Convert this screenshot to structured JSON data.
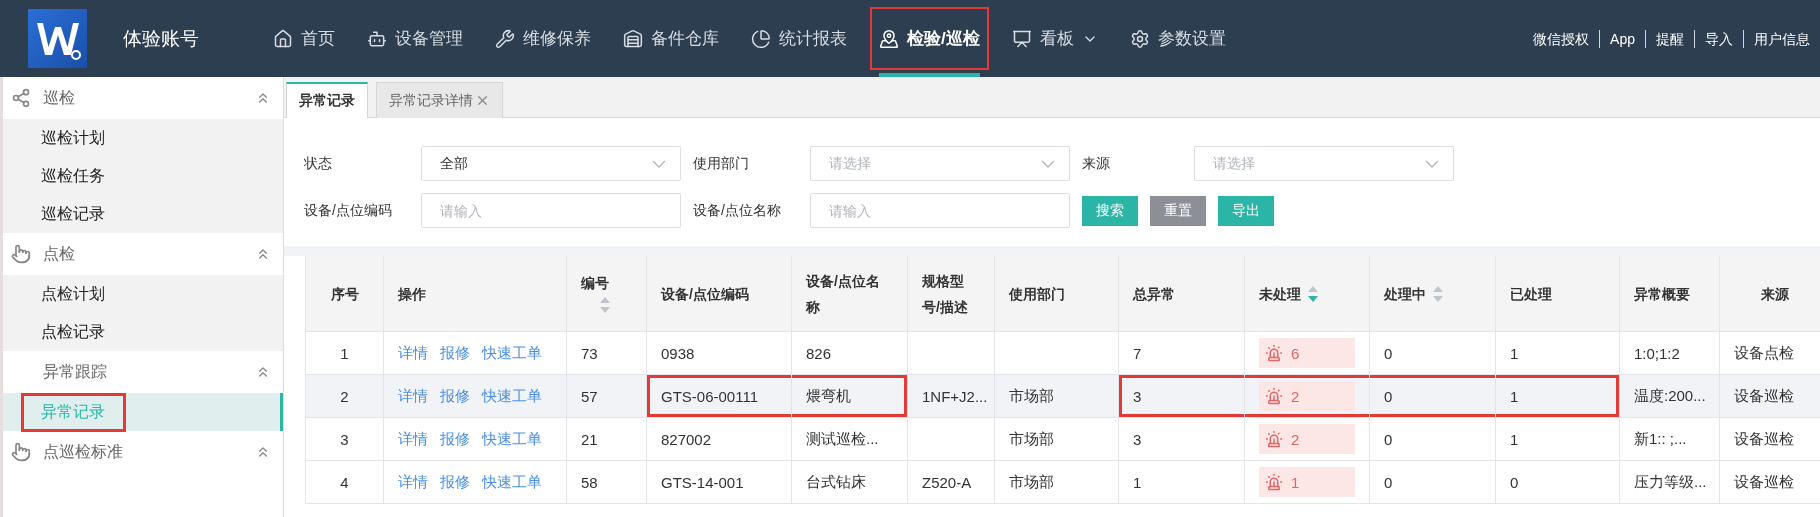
{
  "header": {
    "account": "体验账号",
    "nav": [
      {
        "label": "首页",
        "selected": false,
        "highlighted": false,
        "dropdown": false
      },
      {
        "label": "设备管理",
        "selected": false,
        "highlighted": false,
        "dropdown": false
      },
      {
        "label": "维修保养",
        "selected": false,
        "highlighted": false,
        "dropdown": false
      },
      {
        "label": "备件仓库",
        "selected": false,
        "highlighted": false,
        "dropdown": false
      },
      {
        "label": "统计报表",
        "selected": false,
        "highlighted": false,
        "dropdown": false
      },
      {
        "label": "检验/巡检",
        "selected": true,
        "highlighted": true,
        "dropdown": false
      },
      {
        "label": "看板",
        "selected": false,
        "highlighted": false,
        "dropdown": true
      },
      {
        "label": "参数设置",
        "selected": false,
        "highlighted": false,
        "dropdown": false
      }
    ],
    "links": [
      "微信授权",
      "App",
      "提醒",
      "导入",
      "用户信息"
    ]
  },
  "sidebar": {
    "groups": [
      {
        "label": "巡检",
        "expanded": true,
        "children": [
          {
            "label": "巡检计划",
            "selected": false,
            "highlighted": false
          },
          {
            "label": "巡检任务",
            "selected": false,
            "highlighted": false
          },
          {
            "label": "巡检记录",
            "selected": false,
            "highlighted": false
          }
        ]
      },
      {
        "label": "点检",
        "expanded": true,
        "children": [
          {
            "label": "点检计划",
            "selected": false,
            "highlighted": false
          },
          {
            "label": "点检记录",
            "selected": false,
            "highlighted": false
          }
        ]
      },
      {
        "label": "异常跟踪",
        "expanded": true,
        "children": [
          {
            "label": "异常记录",
            "selected": true,
            "highlighted": true
          }
        ]
      },
      {
        "label": "点巡检标准",
        "expanded": true
      }
    ]
  },
  "tabs": [
    {
      "label": "异常记录",
      "selected": true,
      "closable": false
    },
    {
      "label": "异常记录详情",
      "selected": false,
      "closable": true
    }
  ],
  "filters": [
    {
      "label": "状态",
      "kind": "select",
      "value": "全部"
    },
    {
      "label": "使用部门",
      "kind": "select",
      "placeholder": "请选择"
    },
    {
      "label": "来源",
      "kind": "select",
      "placeholder": "请选择"
    },
    {
      "label": "设备/点位编码",
      "kind": "input",
      "placeholder": "请输入"
    },
    {
      "label": "设备/点位名称",
      "kind": "input",
      "placeholder": "请输入"
    }
  ],
  "buttons": [
    {
      "label": "搜索",
      "kind": "primary"
    },
    {
      "label": "重置",
      "kind": "secondary"
    },
    {
      "label": "导出",
      "kind": "primary"
    }
  ],
  "table": {
    "columns": [
      {
        "label": "序号",
        "sortable": false
      },
      {
        "label": "操作",
        "sortable": false
      },
      {
        "label": "编号",
        "sortable": true,
        "sorted_desc": false
      },
      {
        "label": "设备/点位编码",
        "sortable": false
      },
      {
        "label": "设备/点位名称",
        "sortable": false
      },
      {
        "label": "规格型号/描述",
        "sortable": false
      },
      {
        "label": "使用部门",
        "sortable": false
      },
      {
        "label": "总异常",
        "sortable": false
      },
      {
        "label": "未处理",
        "sortable": true,
        "sorted_desc": true
      },
      {
        "label": "处理中",
        "sortable": true,
        "sorted_desc": false
      },
      {
        "label": "已处理",
        "sortable": false
      },
      {
        "label": "异常概要",
        "sortable": false
      },
      {
        "label": "来源",
        "sortable": false
      }
    ],
    "rows": [
      {
        "hovered": false,
        "cells": [
          "1",
          [
            "详情",
            "报修",
            "快速工单"
          ],
          "73",
          "0938",
          "826",
          null,
          null,
          "7",
          "6",
          "0",
          "1",
          "1:0;1:2",
          "设备点检"
        ],
        "outlined": [
          false,
          false,
          false,
          false,
          false,
          false,
          false,
          false,
          false,
          false,
          false,
          false,
          false
        ]
      },
      {
        "hovered": true,
        "cells": [
          "2",
          [
            "详情",
            "报修",
            "快速工单"
          ],
          "57",
          "GTS-06-00111",
          "煨弯机",
          "1NF+J2...",
          "市场部",
          "3",
          "2",
          "0",
          "1",
          "温度:200...",
          "设备巡检"
        ],
        "outlined": [
          false,
          false,
          false,
          true,
          true,
          false,
          false,
          true,
          true,
          true,
          true,
          false,
          false
        ]
      },
      {
        "hovered": false,
        "cells": [
          "3",
          [
            "详情",
            "报修",
            "快速工单"
          ],
          "21",
          "827002",
          "测试巡检...",
          null,
          "市场部",
          "3",
          "2",
          "0",
          "1",
          "新1::  ;...",
          "设备巡检"
        ],
        "outlined": [
          false,
          false,
          false,
          false,
          false,
          false,
          false,
          false,
          false,
          false,
          false,
          false,
          false
        ]
      },
      {
        "hovered": false,
        "cells": [
          "4",
          [
            "详情",
            "报修",
            "快速工单"
          ],
          "58",
          "GTS-14-001",
          "台式钻床",
          "Z520-A",
          "市场部",
          "1",
          "1",
          "0",
          "0",
          "压力等级...",
          "设备巡检"
        ],
        "outlined": [
          false,
          false,
          false,
          false,
          false,
          false,
          false,
          false,
          false,
          false,
          false,
          false,
          false
        ]
      }
    ]
  }
}
